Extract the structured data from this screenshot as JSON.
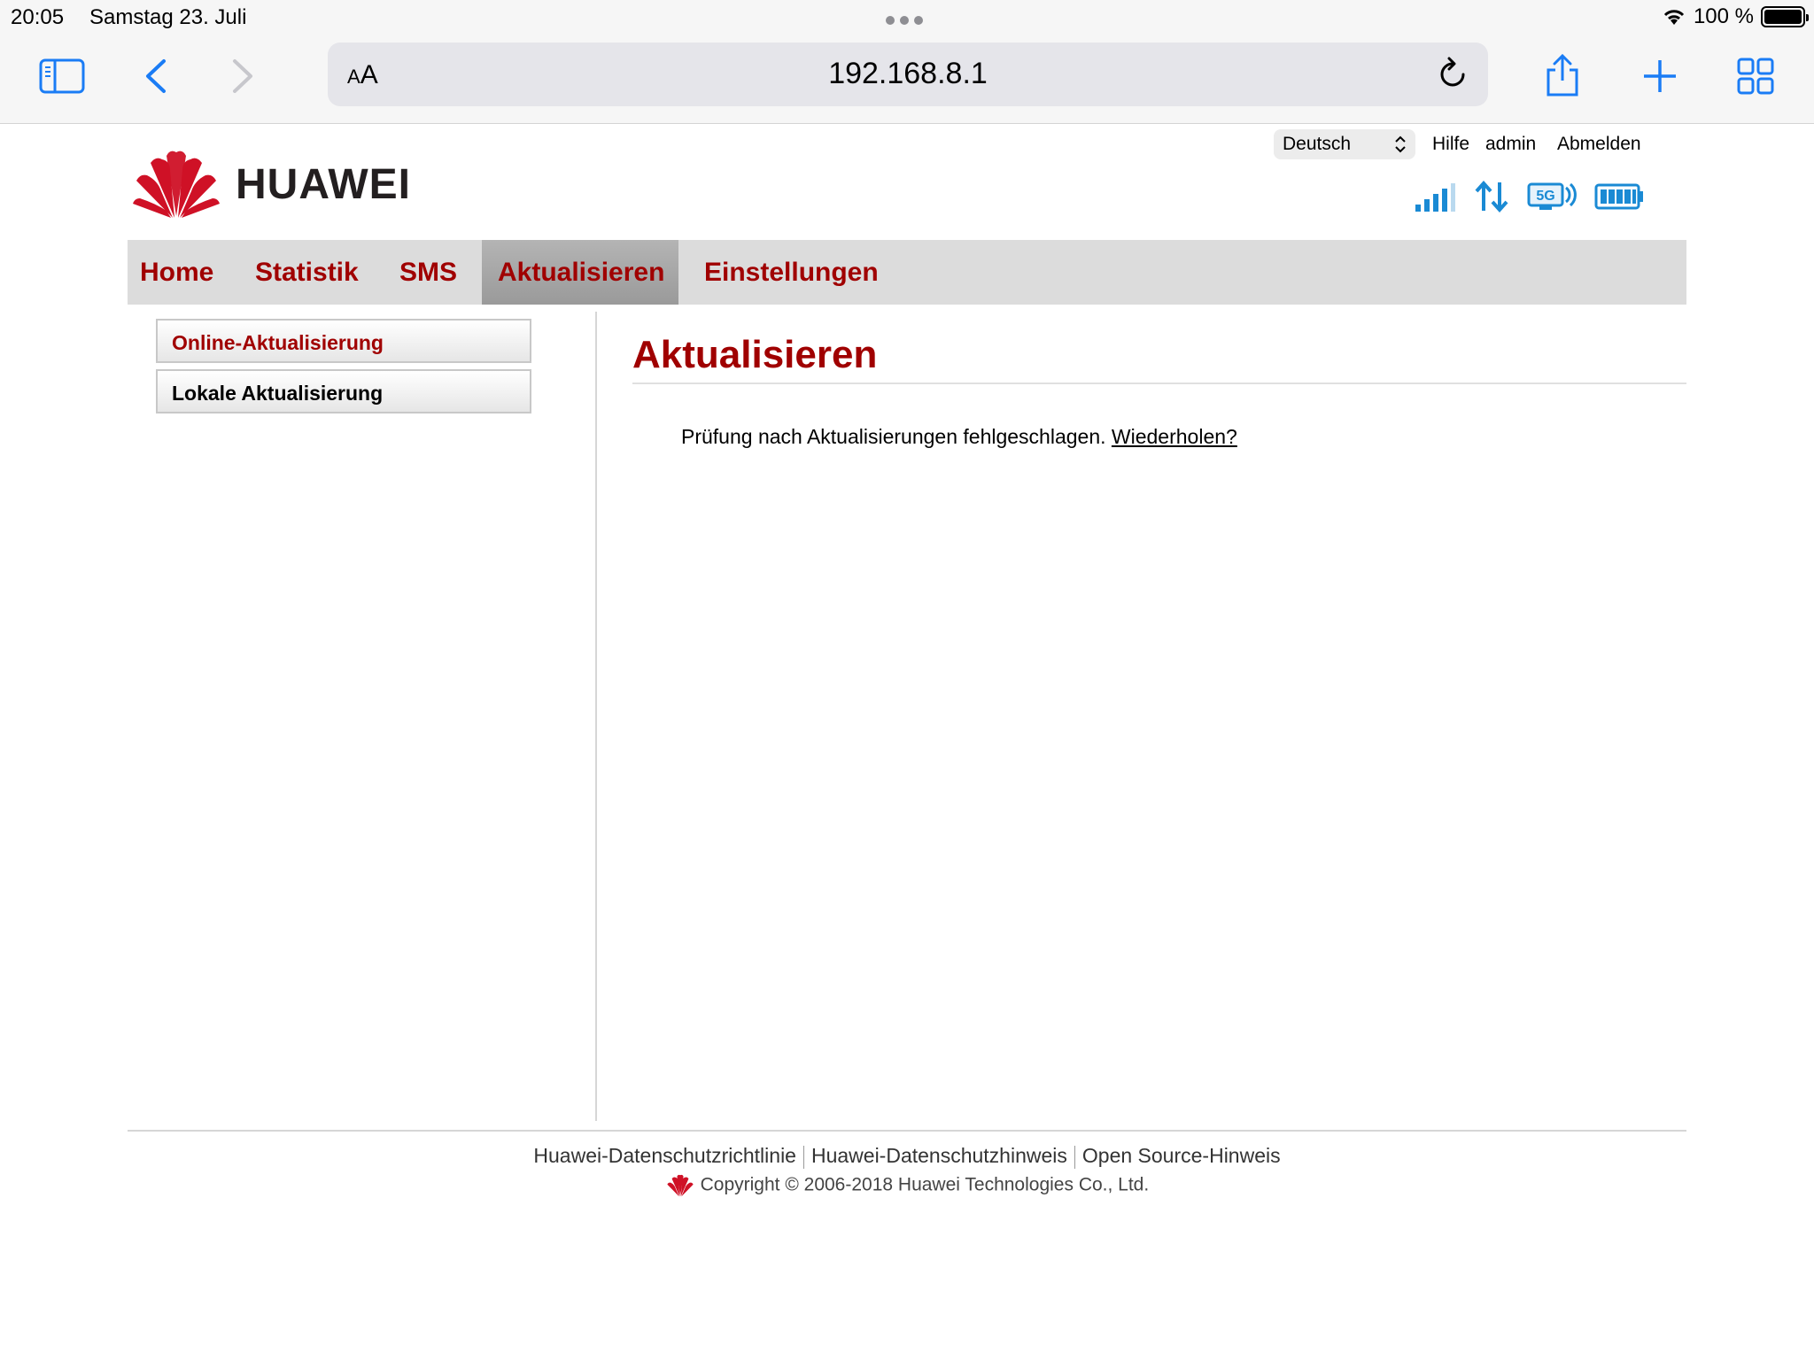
{
  "status_bar": {
    "time": "20:05",
    "date": "Samstag 23. Juli",
    "battery_percent": "100 %",
    "battery_level": 1.0
  },
  "browser": {
    "url": "192.168.8.1",
    "text_size_small": "A",
    "text_size_large": "A",
    "icons": [
      "sidebar-icon",
      "back-icon",
      "forward-icon",
      "reload-icon",
      "share-icon",
      "new-tab-icon",
      "tabs-overview-icon"
    ]
  },
  "header": {
    "language": "Deutsch",
    "help": "Hilfe",
    "user": "admin",
    "logout": "Abmelden",
    "brand": "HUAWEI",
    "network_type": "5G"
  },
  "nav": {
    "items": [
      {
        "label": "Home"
      },
      {
        "label": "Statistik"
      },
      {
        "label": "SMS"
      },
      {
        "label": "Aktualisieren",
        "active": true
      },
      {
        "label": "Einstellungen"
      }
    ]
  },
  "sidebar": {
    "items": [
      {
        "label": "Online-Aktualisierung",
        "active": true
      },
      {
        "label": "Lokale Aktualisierung"
      }
    ]
  },
  "content": {
    "title": "Aktualisieren",
    "message": "Prüfung nach Aktualisierungen fehlgeschlagen.",
    "retry_link": "Wiederholen?"
  },
  "footer": {
    "links": [
      "Huawei-Datenschutzrichtlinie",
      "Huawei-Datenschutzhinweis",
      "Open Source-Hinweis"
    ],
    "copyright": "Copyright © 2006-2018 Huawei Technologies Co., Ltd."
  },
  "colors": {
    "brand_red": "#a00000",
    "signal_blue": "#1a8ad4"
  }
}
